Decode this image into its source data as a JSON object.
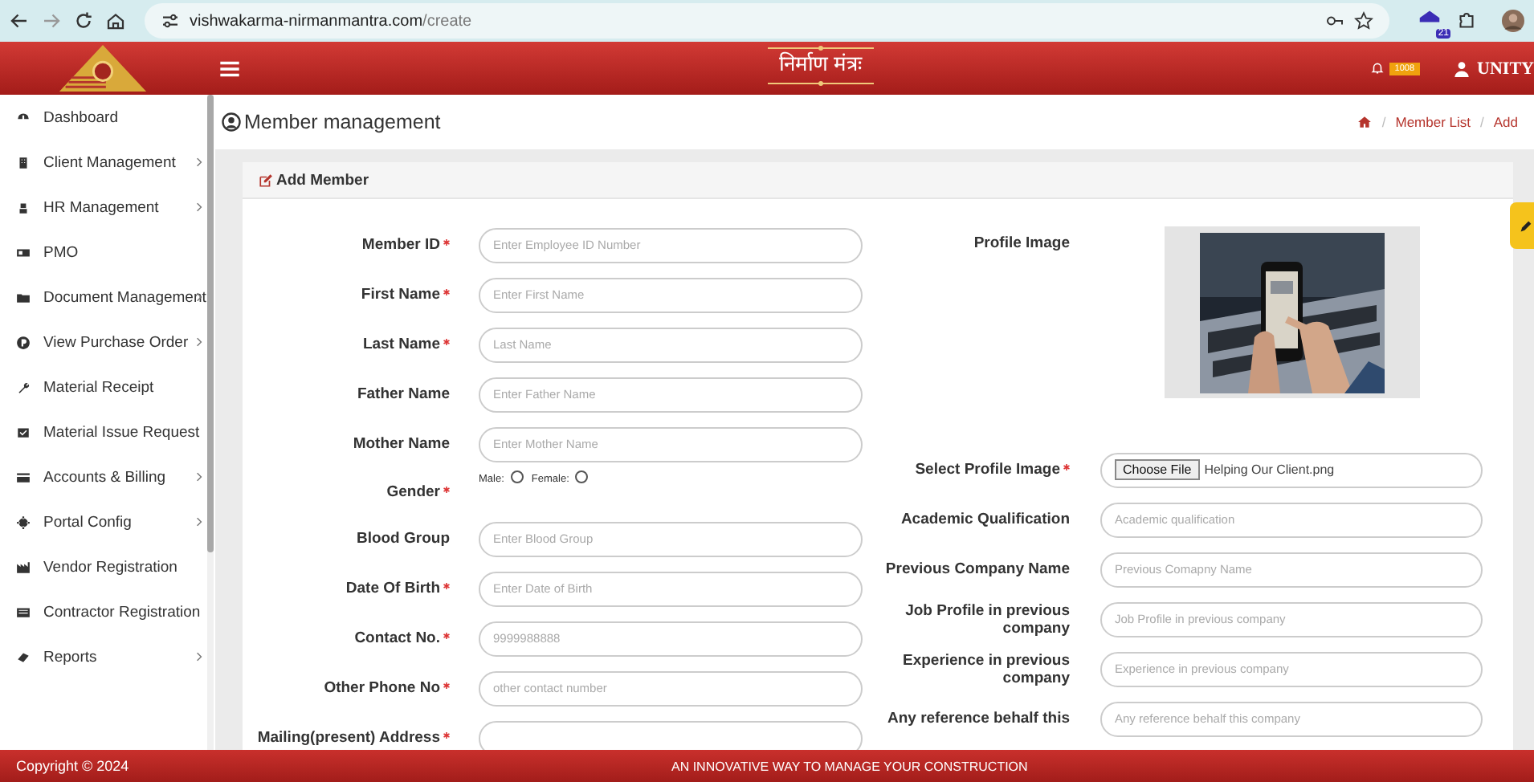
{
  "browser": {
    "url_host": "vishwakarma-nirmanmantra.com",
    "url_path": "/create",
    "extension_badge": "21"
  },
  "header": {
    "title": "निर्माण मंत्रः",
    "notification_badge": "1008",
    "user_name": "UNITY"
  },
  "sidebar": {
    "items": [
      {
        "label": "Dashboard",
        "has_submenu": false
      },
      {
        "label": "Client Management",
        "has_submenu": true
      },
      {
        "label": "HR Management",
        "has_submenu": true
      },
      {
        "label": "PMO",
        "has_submenu": false
      },
      {
        "label": "Document Management",
        "has_submenu": true
      },
      {
        "label": "View Purchase Order",
        "has_submenu": true
      },
      {
        "label": "Material Receipt",
        "has_submenu": false
      },
      {
        "label": "Material Issue Request",
        "has_submenu": false
      },
      {
        "label": "Accounts & Billing",
        "has_submenu": true
      },
      {
        "label": "Portal Config",
        "has_submenu": true
      },
      {
        "label": "Vendor Registration",
        "has_submenu": false
      },
      {
        "label": "Contractor Registration",
        "has_submenu": false
      },
      {
        "label": "Reports",
        "has_submenu": true
      }
    ]
  },
  "page": {
    "title": "Member management",
    "breadcrumb": [
      {
        "kind": "home"
      },
      {
        "kind": "separator",
        "text": "/"
      },
      {
        "kind": "link",
        "text": "Member List"
      },
      {
        "kind": "separator",
        "text": "/"
      },
      {
        "kind": "current",
        "text": "Add"
      }
    ]
  },
  "card": {
    "title": "Add Member"
  },
  "form_left": [
    {
      "kind": "text",
      "label": "Member ID",
      "required": true,
      "placeholder": "Enter Employee ID Number"
    },
    {
      "kind": "text",
      "label": "First Name",
      "required": true,
      "placeholder": "Enter First Name"
    },
    {
      "kind": "text",
      "label": "Last Name",
      "required": true,
      "placeholder": "Last Name"
    },
    {
      "kind": "text",
      "label": "Father Name",
      "required": false,
      "placeholder": "Enter Father Name"
    },
    {
      "kind": "text",
      "label": "Mother Name",
      "required": false,
      "placeholder": "Enter Mother Name"
    },
    {
      "kind": "radio",
      "label": "Gender",
      "required": true,
      "options": [
        {
          "label": "Male:",
          "selected": false
        },
        {
          "label": "Female:",
          "selected": false
        }
      ]
    },
    {
      "kind": "text",
      "label": "Blood Group",
      "required": false,
      "placeholder": "Enter Blood Group"
    },
    {
      "kind": "text",
      "label": "Date Of Birth",
      "required": true,
      "placeholder": "Enter Date of Birth"
    },
    {
      "kind": "text",
      "label": "Contact No.",
      "required": true,
      "placeholder": "9999988888"
    },
    {
      "kind": "text",
      "label": "Other Phone No",
      "required": true,
      "placeholder": "other contact number"
    },
    {
      "kind": "text",
      "label": "Mailing(present) Address",
      "required": true
    }
  ],
  "form_right": [
    {
      "label": "Profile Image",
      "required": false
    },
    {
      "kind": "file",
      "label": "Select Profile Image",
      "required": true,
      "button": "Choose File",
      "value": "Helping Our Client.png"
    },
    {
      "kind": "text",
      "label": "Academic Qualification",
      "required": false,
      "placeholder": "Academic qualification"
    },
    {
      "kind": "text",
      "label": "Previous Company Name",
      "required": false,
      "placeholder": "Previous Comapny Name"
    },
    {
      "kind": "text",
      "label": "Job Profile in previous company",
      "required": false,
      "placeholder": "Job Profile in previous company"
    },
    {
      "kind": "text",
      "label": "Experience in previous company",
      "required": false,
      "placeholder": "Experience in previous company"
    },
    {
      "kind": "text",
      "label": "Any reference behalf this",
      "required": false,
      "placeholder": "Any reference behalf this company"
    }
  ],
  "footer": {
    "copyright": "Copyright © 2024",
    "tagline": "AN INNOVATIVE WAY TO MANAGE YOUR CONSTRUCTION"
  }
}
